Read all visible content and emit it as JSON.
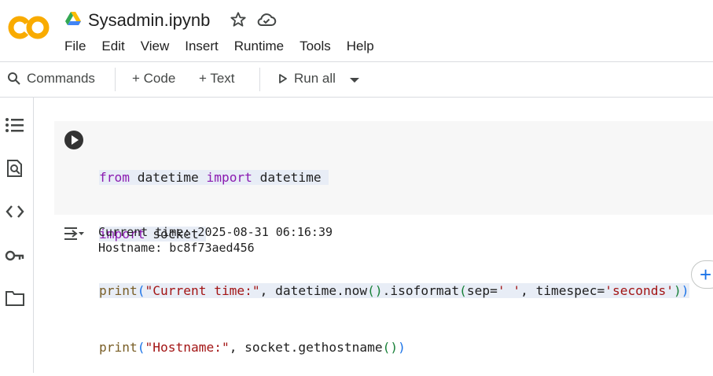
{
  "app": {
    "logo_text": "CO",
    "title": "Sysadmin.ipynb",
    "colors": {
      "logo": "#f9ab00",
      "accent": "#1a73e8"
    }
  },
  "menu": [
    "File",
    "Edit",
    "View",
    "Insert",
    "Runtime",
    "Tools",
    "Help"
  ],
  "toolbar": {
    "commands": "Commands",
    "add_code": "+ Code",
    "add_text": "+ Text",
    "run_all": "Run all"
  },
  "sidebar": {
    "icons": [
      "table-of-contents-icon",
      "find-replace-icon",
      "code-snippets-icon",
      "secrets-key-icon",
      "files-folder-icon"
    ]
  },
  "cell": {
    "code_lines": [
      "from datetime import datetime",
      "import socket",
      "print(\"Current time:\", datetime.now().isoformat(sep=' ', timespec='seconds'))",
      "print(\"Hostname:\", socket.gethostname())"
    ],
    "output_lines": [
      "Current time: 2025-08-31 06:16:39",
      "Hostname: bc8f73aed456"
    ]
  },
  "add_button": "+"
}
